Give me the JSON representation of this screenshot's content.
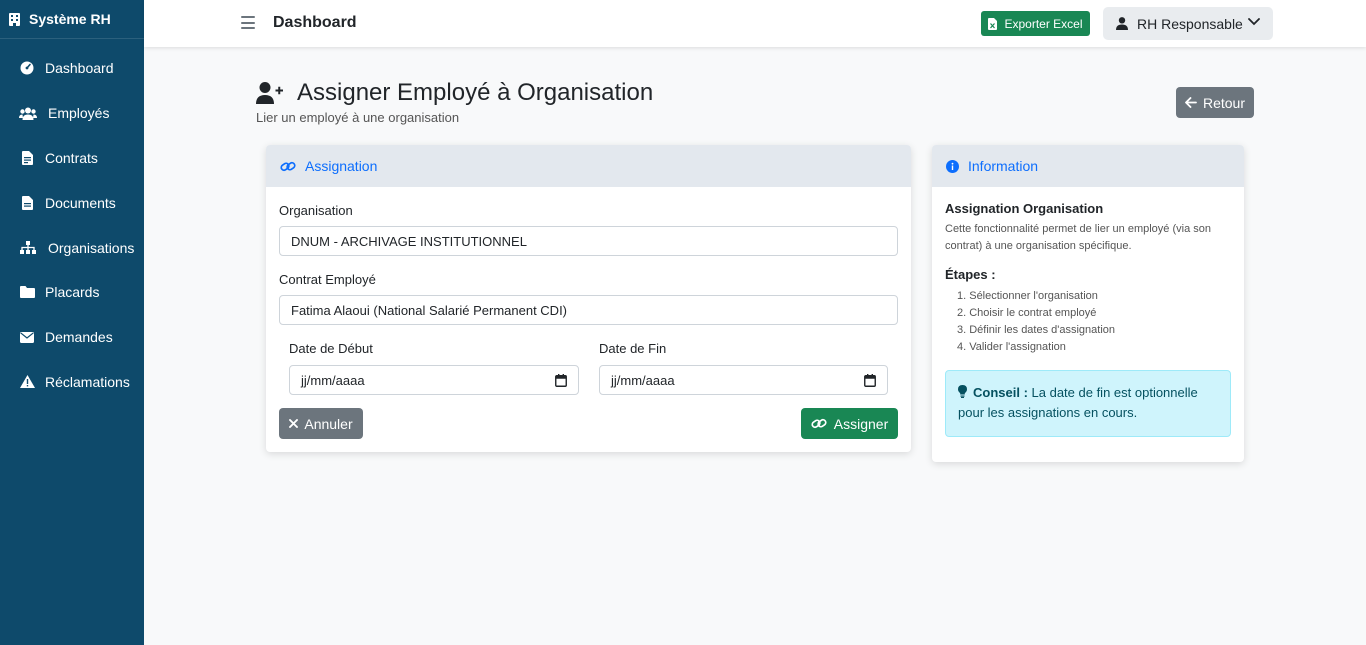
{
  "sidebar": {
    "brand": "Système RH",
    "items": [
      {
        "label": "Dashboard",
        "icon": "gauge-icon"
      },
      {
        "label": "Employés",
        "icon": "users-icon"
      },
      {
        "label": "Contrats",
        "icon": "file-contract-icon"
      },
      {
        "label": "Documents",
        "icon": "file-icon"
      },
      {
        "label": "Organisations",
        "icon": "sitemap-icon"
      },
      {
        "label": "Placards",
        "icon": "folder-icon"
      },
      {
        "label": "Demandes",
        "icon": "envelope-icon"
      },
      {
        "label": "Réclamations",
        "icon": "warning-icon"
      }
    ]
  },
  "topbar": {
    "title": "Dashboard",
    "export_label": "Exporter Excel",
    "user_label": "RH Responsable"
  },
  "header": {
    "title": "Assigner Employé à Organisation",
    "subtitle": "Lier un employé à une organisation",
    "back_label": "Retour"
  },
  "form": {
    "card_title": "Assignation",
    "organisation_label": "Organisation",
    "organisation_value": "DNUM - ARCHIVAGE INSTITUTIONNEL",
    "contrat_label": "Contrat Employé",
    "contrat_value": "Fatima Alaoui (National Salarié Permanent CDI)",
    "date_debut_label": "Date de Début",
    "date_debut_value": "jj/mm/aaaa",
    "date_fin_label": "Date de Fin",
    "date_fin_value": "jj/mm/aaaa",
    "cancel_label": "Annuler",
    "submit_label": "Assigner"
  },
  "info": {
    "card_title": "Information",
    "title": "Assignation Organisation",
    "description": "Cette fonctionnalité permet de lier un employé (via son contrat) à une organisation spécifique.",
    "steps_title": "Étapes :",
    "steps": [
      "1. Sélectionner l'organisation",
      "2. Choisir le contrat employé",
      "3. Définir les dates d'assignation",
      "4. Valider l'assignation"
    ],
    "tip_label": "Conseil :",
    "tip_text": " La date de fin est optionnelle pour les assignations en cours."
  },
  "colors": {
    "sidebar": "#0e4a6b",
    "primary": "#0d6efd",
    "success": "#198754",
    "secondary": "#6c757d",
    "info_bg": "#cff4fc"
  }
}
